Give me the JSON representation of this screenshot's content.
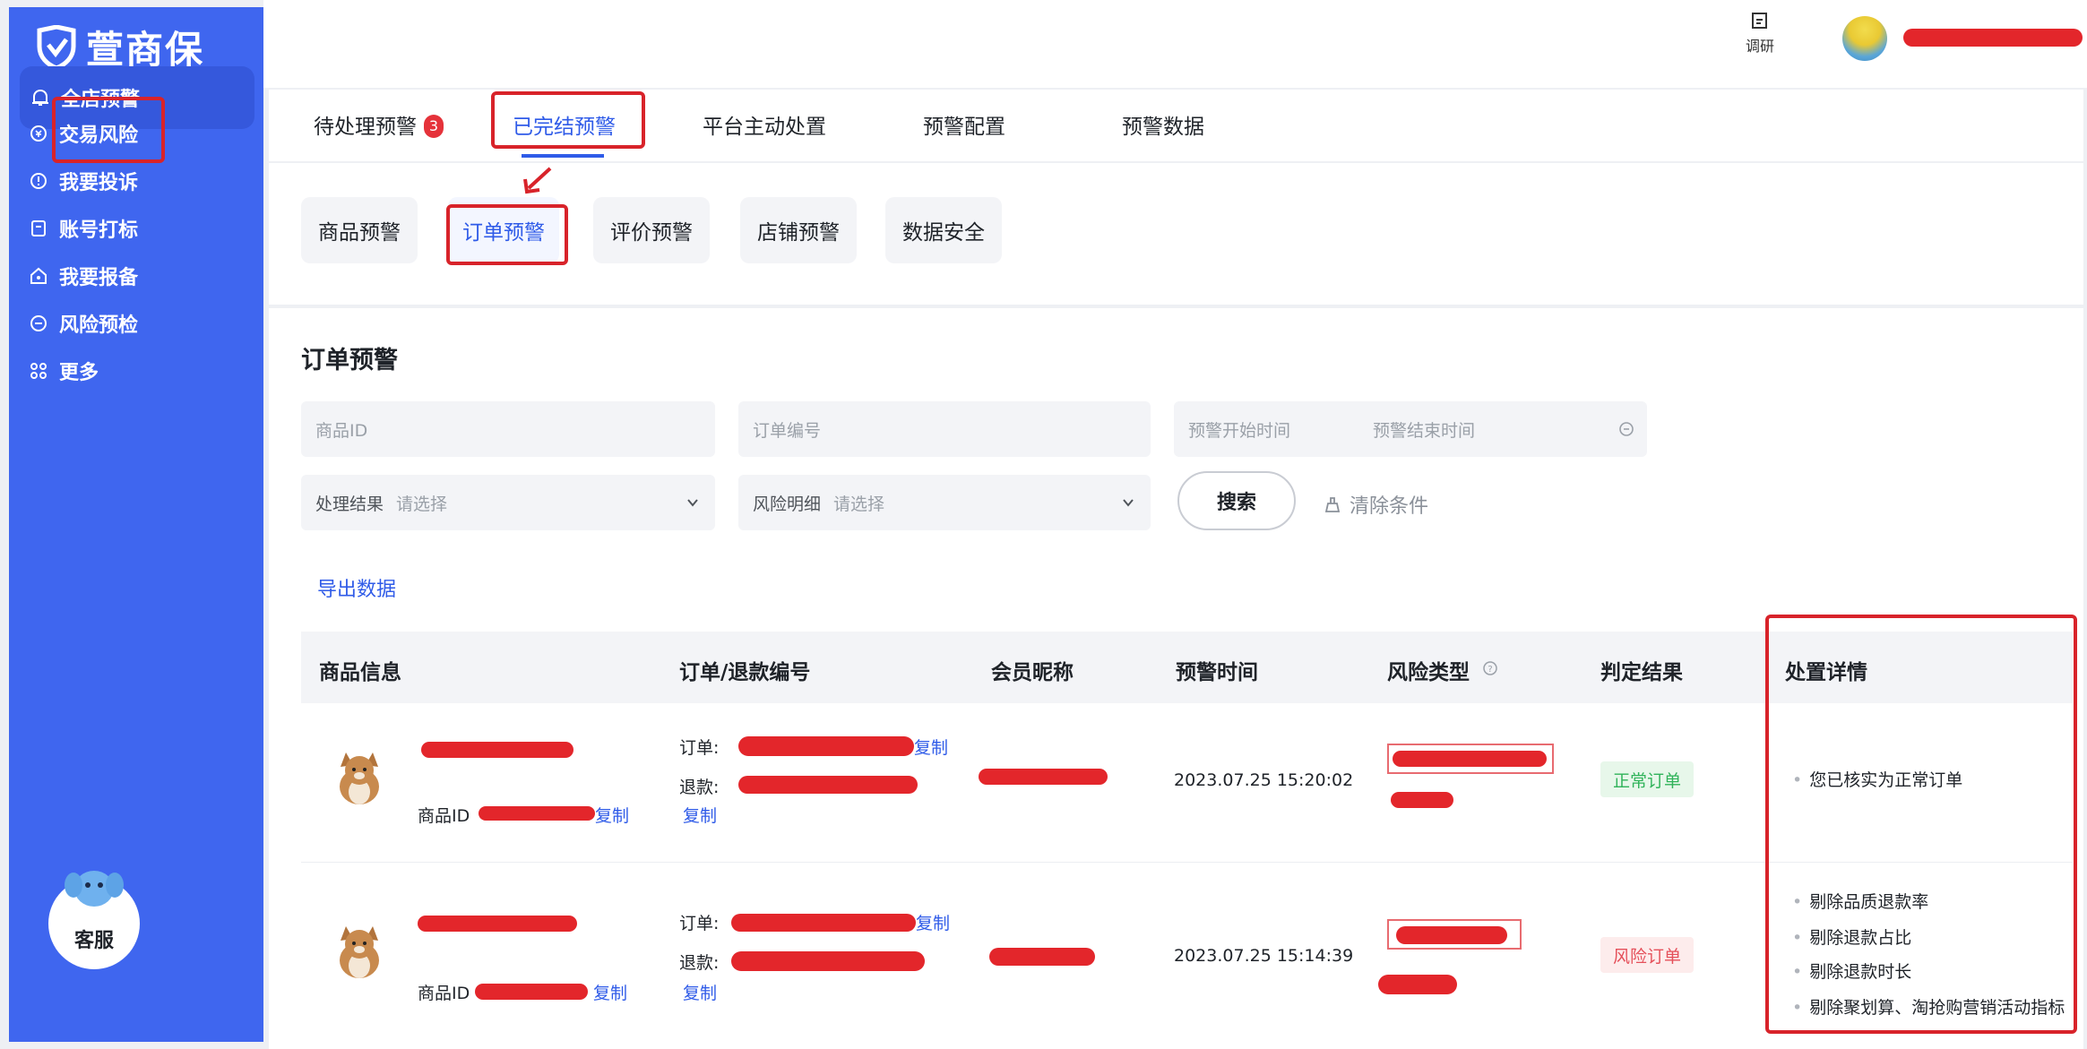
{
  "brand": {
    "name": "萱商保"
  },
  "sidebar": {
    "items": [
      {
        "label": "全店预警",
        "icon": "bell-icon"
      },
      {
        "label": "交易风险",
        "icon": "currency-icon"
      },
      {
        "label": "我要投诉",
        "icon": "info-icon"
      },
      {
        "label": "账号打标",
        "icon": "tag-icon"
      },
      {
        "label": "我要报备",
        "icon": "home-icon"
      },
      {
        "label": "风险预检",
        "icon": "check-icon"
      },
      {
        "label": "更多",
        "icon": "grid-icon"
      }
    ],
    "service_label": "客服"
  },
  "topbar": {
    "survey_label": "调研"
  },
  "tabs": [
    {
      "label": "待处理预警",
      "badge": "3"
    },
    {
      "label": "已完结预警"
    },
    {
      "label": "平台主动处置"
    },
    {
      "label": "预警配置"
    },
    {
      "label": "预警数据"
    }
  ],
  "subtabs": [
    "商品预警",
    "订单预警",
    "评价预警",
    "店铺预警",
    "数据安全"
  ],
  "filters": {
    "title": "订单预警",
    "product_id_placeholder": "商品ID",
    "order_no_placeholder": "订单编号",
    "start_time_placeholder": "预警开始时间",
    "end_time_placeholder": "预警结束时间",
    "result_label": "处理结果",
    "result_placeholder": "请选择",
    "risk_label": "风险明细",
    "risk_placeholder": "请选择",
    "search_label": "搜索",
    "clear_label": "清除条件",
    "export_label": "导出数据"
  },
  "table": {
    "headers": [
      "商品信息",
      "订单/退款编号",
      "会员昵称",
      "预警时间",
      "风险类型",
      "判定结果",
      "处置详情"
    ],
    "rows": [
      {
        "product_id_label": "商品ID",
        "copy_label": "复制",
        "order_label": "订单:",
        "refund_label": "退款:",
        "time": "2023.07.25 15:20:02",
        "result": "正常订单",
        "details": [
          "您已核实为正常订单"
        ]
      },
      {
        "product_id_label": "商品ID",
        "copy_label": "复制",
        "order_label": "订单:",
        "refund_label": "退款:",
        "time": "2023.07.25 15:14:39",
        "result": "风险订单",
        "details": [
          "剔除品质退款率",
          "剔除退款占比",
          "剔除退款时长",
          "剔除聚划算、淘抢购营销活动指标"
        ]
      }
    ]
  }
}
